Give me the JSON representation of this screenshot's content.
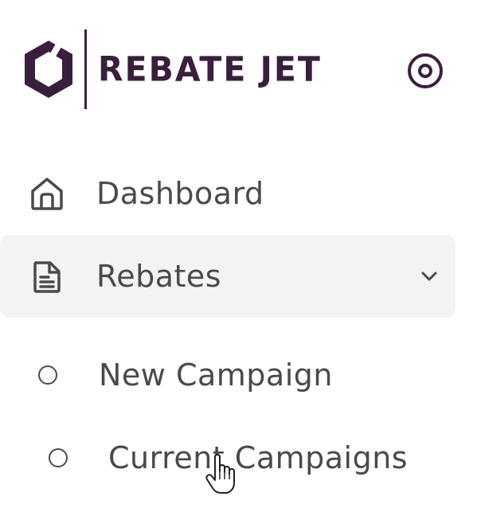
{
  "brand": {
    "name": "REBATE JET",
    "color": "#3a1f3d",
    "logo_icon": "hexagon-logo-icon"
  },
  "header": {
    "collapse_icon": "target-circle-icon"
  },
  "nav": {
    "items": [
      {
        "label": "Dashboard",
        "icon": "home-icon",
        "active": false
      },
      {
        "label": "Rebates",
        "icon": "document-icon",
        "active": true,
        "expanded": true
      }
    ],
    "sub_items": [
      {
        "label": "New Campaign",
        "icon": "circle-bullet-icon"
      },
      {
        "label": "Current Campaigns",
        "icon": "circle-bullet-icon"
      }
    ]
  },
  "colors": {
    "text": "#4a4a4a",
    "active_background": "#f3f3f3",
    "brand": "#3a1f3d"
  },
  "cursor": {
    "icon": "hand-pointer-icon"
  }
}
